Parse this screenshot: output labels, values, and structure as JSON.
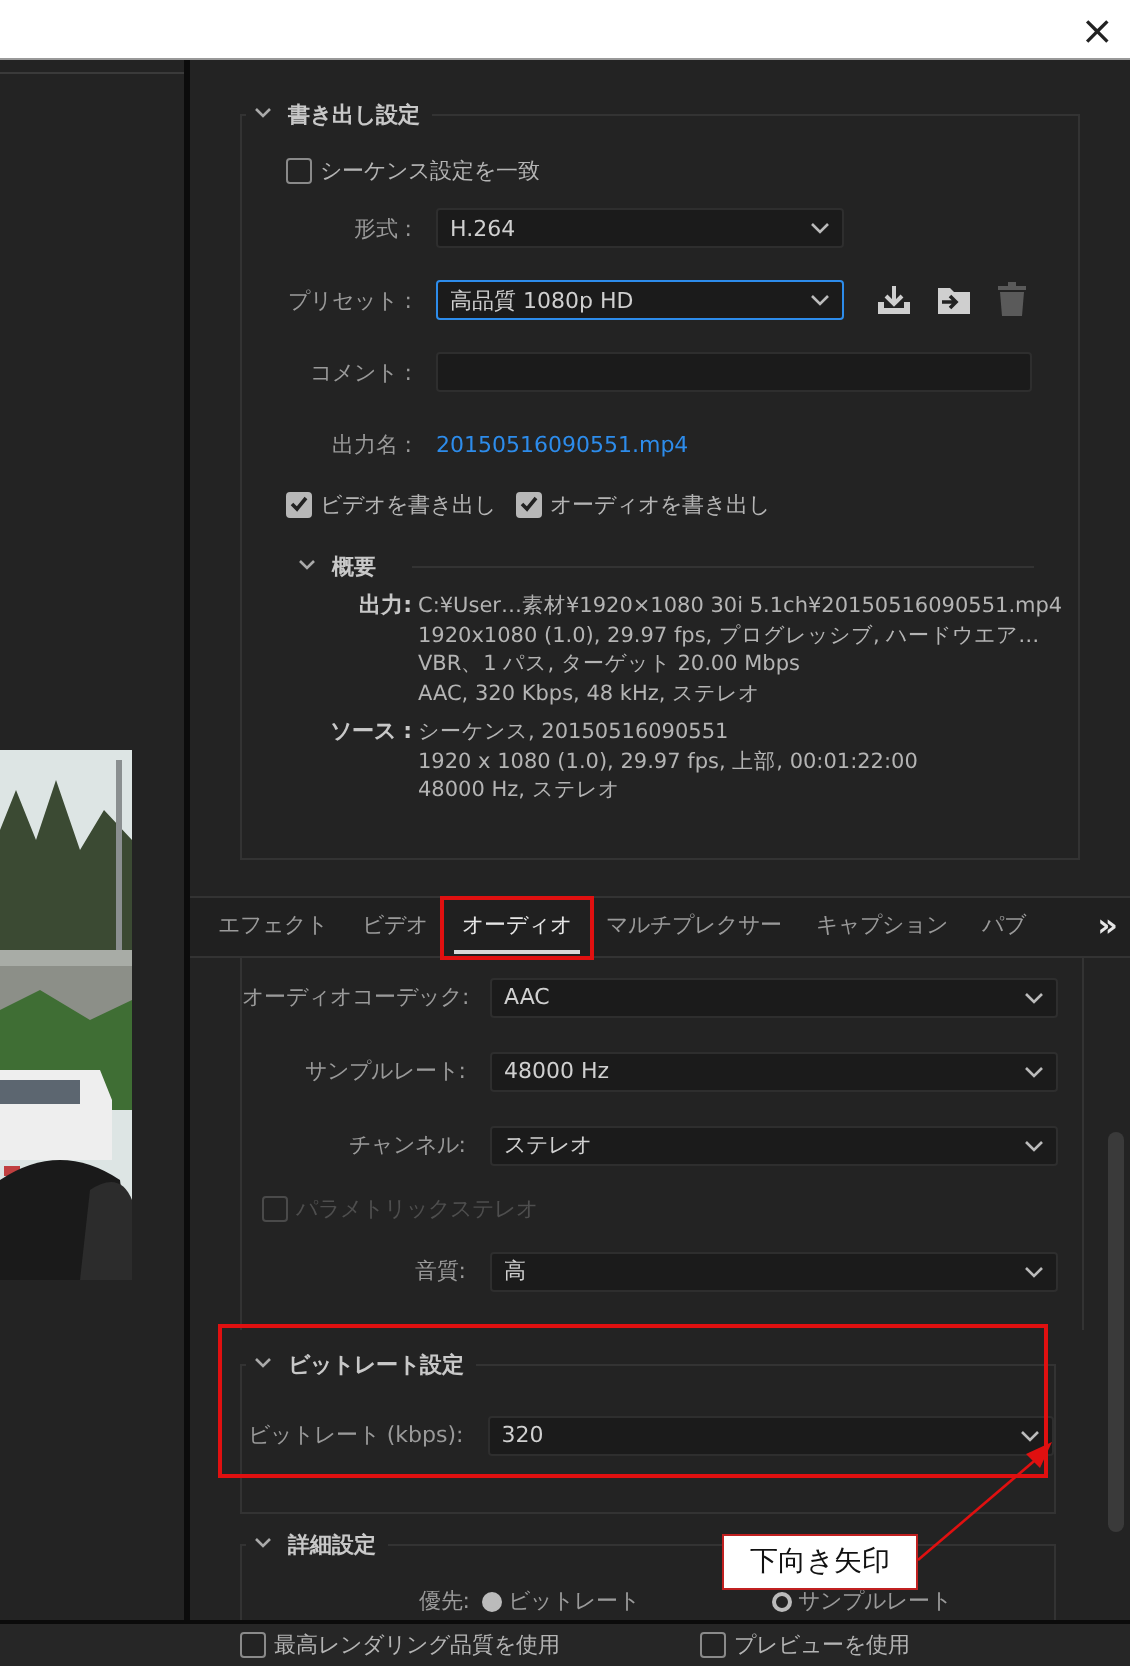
{
  "window": {
    "close": "×"
  },
  "export_settings": {
    "title": "書き出し設定",
    "expanded": true,
    "match_sequence": {
      "label": "シーケンス設定を一致",
      "checked": false
    },
    "fields": [
      {
        "kind": "dropdown",
        "label": "形式 :",
        "value": "H.264",
        "focused": false
      },
      {
        "kind": "dropdown",
        "label": "プリセット :",
        "value": "高品質  1080p HD",
        "focused": true
      },
      {
        "kind": "text",
        "label": "コメント :"
      },
      {
        "kind": "link",
        "label": "出力名 :",
        "value": "20150516090551.mp4"
      }
    ],
    "export_checks": [
      {
        "label": "ビデオを書き出し",
        "checked": true
      },
      {
        "label": "オーディオを書き出し",
        "checked": true
      }
    ],
    "summary": {
      "title": "概要",
      "expanded": true,
      "groups": [
        {
          "label": "出力:",
          "lines": [
            "C:¥User…素材¥1920×1080  30i 5.1ch¥20150516090551.mp4",
            "1920x1080 (1.0), 29.97 fps, プログレッシブ, ハードウエア…",
            "VBR、1 パス, ターゲット 20.00 Mbps",
            "AAC, 320 Kbps, 48 kHz, ステレオ"
          ]
        },
        {
          "label": "ソース :",
          "lines": [
            "シーケンス, 20150516090551",
            "1920 x 1080 (1.0), 29.97 fps, 上部, 00:01:22:00",
            "48000  Hz, ステレオ"
          ]
        }
      ]
    }
  },
  "tabs": [
    {
      "label": "エフェクト",
      "selected": false
    },
    {
      "label": "ビデオ",
      "selected": false
    },
    {
      "label": "オーディオ",
      "selected": true
    },
    {
      "label": "マルチプレクサー",
      "selected": false
    },
    {
      "label": "キャプション",
      "selected": false
    },
    {
      "label": "パブ",
      "selected": false
    }
  ],
  "tabs_more": "»",
  "audio": {
    "fields": [
      {
        "kind": "dropdown",
        "label": "オーディオコーデック:",
        "value": "AAC"
      },
      {
        "kind": "dropdown",
        "label": "サンプルレート:",
        "value": "48000 Hz"
      },
      {
        "kind": "dropdown",
        "label": "チャンネル:",
        "value": "ステレオ"
      },
      {
        "kind": "checkbox",
        "label": "パラメトリックステレオ",
        "checked": false,
        "disabled": true
      },
      {
        "kind": "dropdown",
        "label": "音質:",
        "value": "高"
      }
    ]
  },
  "bitrate_settings": {
    "title": "ビットレート設定",
    "expanded": true,
    "fields": [
      {
        "label": "ビットレート (kbps):",
        "value": "320"
      }
    ]
  },
  "advanced_settings": {
    "title": "詳細設定",
    "expanded": true,
    "priority": {
      "label": "優先:",
      "options": [
        {
          "label": "ビットレート",
          "selected": true
        },
        {
          "label": "サンプルレート",
          "selected": false
        }
      ]
    }
  },
  "footer": {
    "checks": [
      {
        "label": "最高レンダリング品質を使用",
        "checked": false
      },
      {
        "label": "プレビューを使用",
        "checked": false
      }
    ]
  },
  "annotation": {
    "callout": "下向き矢印"
  }
}
